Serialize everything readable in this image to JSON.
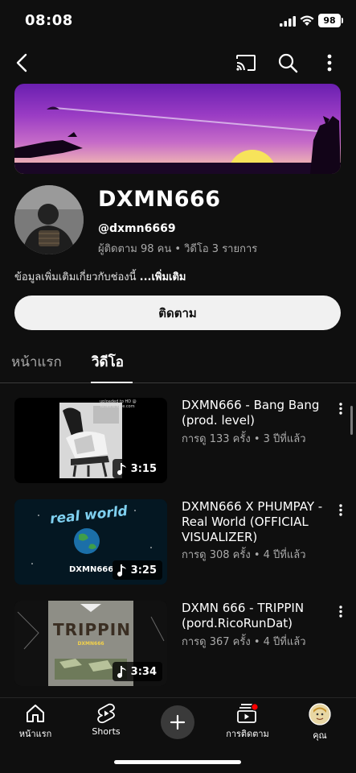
{
  "status": {
    "time": "08:08",
    "battery": "98"
  },
  "channel": {
    "name": "DXMN666",
    "handle": "@dxmn6669",
    "stats": "ผู้ติดตาม 98 คน • วิดีโอ 3 รายการ",
    "about": "ข้อมูลเพิ่มเติมเกี่ยวกับช่องนี้",
    "about_more": "...เพิ่มเติม",
    "subscribe_label": "ติดตาม"
  },
  "tabs": [
    {
      "label": "หน้าแรก",
      "active": false
    },
    {
      "label": "วิดีโอ",
      "active": true
    }
  ],
  "videos": [
    {
      "title": "DXMN666 - Bang Bang (prod. level)",
      "meta": "การดู 133 ครั้ง • 3 ปีที่แล้ว",
      "duration": "3:15",
      "thumb_caption": "uploaded to HD @ TunesToTube.com"
    },
    {
      "title": "DXMN666 X PHUMPAY - Real World (OFFICIAL VISUALIZER)",
      "meta": "การดู 308 ครั้ง • 4 ปีที่แล้ว",
      "duration": "3:25",
      "thumb_text_top": "real world",
      "thumb_text_bottom": "DXMN666"
    },
    {
      "title": "DXMN 666 - TRIPPIN (pord.RicoRunDat)",
      "meta": "การดู 367 ครั้ง • 4 ปีที่แล้ว",
      "duration": "3:34",
      "thumb_text_top": "TRIPPIN",
      "thumb_text_sub": "DXMN666"
    }
  ],
  "bottom_nav": [
    {
      "label": "หน้าแรก",
      "icon": "home-icon"
    },
    {
      "label": "Shorts",
      "icon": "shorts-icon"
    },
    {
      "label": "",
      "icon": "create-icon"
    },
    {
      "label": "การติดตาม",
      "icon": "subscriptions-icon"
    },
    {
      "label": "คุณ",
      "icon": "you-avatar"
    }
  ],
  "colors": {
    "background": "#0f0f0f",
    "secondary_text": "#aaaaaa",
    "notification": "#ff0000",
    "button": "#f1f1f1"
  }
}
